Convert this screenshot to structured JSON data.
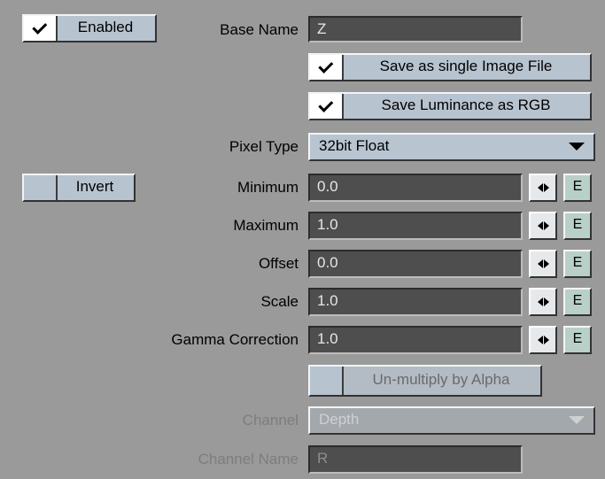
{
  "enabled": {
    "label": "Enabled",
    "checked": true
  },
  "base_name": {
    "label": "Base Name",
    "value": "Z"
  },
  "save_single": {
    "label": "Save as single Image File",
    "checked": true
  },
  "save_luminance": {
    "label": "Save Luminance as RGB",
    "checked": true
  },
  "pixel_type": {
    "label": "Pixel Type",
    "value": "32bit Float"
  },
  "invert": {
    "label": "Invert",
    "checked": false
  },
  "minimum": {
    "label": "Minimum",
    "value": "0.0"
  },
  "maximum": {
    "label": "Maximum",
    "value": "1.0"
  },
  "offset": {
    "label": "Offset",
    "value": "0.0"
  },
  "scale": {
    "label": "Scale",
    "value": "1.0"
  },
  "gamma": {
    "label": "Gamma Correction",
    "value": "1.0"
  },
  "unmultiply": {
    "label": "Un-multiply by Alpha",
    "checked": false
  },
  "channel": {
    "label": "Channel",
    "value": "Depth"
  },
  "channel_name": {
    "label": "Channel Name",
    "value": "R"
  },
  "envelope_label": "E",
  "icons": {
    "checkmark": "checkmark-icon",
    "drag": "left-right-arrows-icon",
    "dropdown": "triangle-down-icon"
  },
  "colors": {
    "background": "#9a9a9a",
    "field": "#4e4e4e",
    "button": "#b7c3cf",
    "envelope_button": "#b8d0c8"
  }
}
